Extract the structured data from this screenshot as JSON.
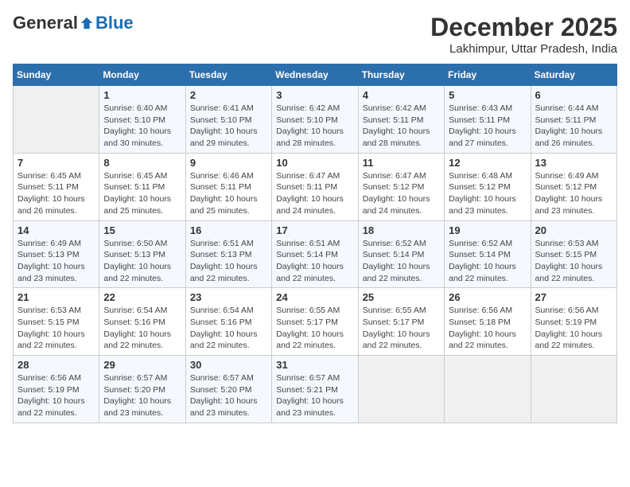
{
  "logo": {
    "general": "General",
    "blue": "Blue"
  },
  "title": "December 2025",
  "subtitle": "Lakhimpur, Uttar Pradesh, India",
  "days_of_week": [
    "Sunday",
    "Monday",
    "Tuesday",
    "Wednesday",
    "Thursday",
    "Friday",
    "Saturday"
  ],
  "weeks": [
    [
      {
        "day": "",
        "info": ""
      },
      {
        "day": "1",
        "info": "Sunrise: 6:40 AM\nSunset: 5:10 PM\nDaylight: 10 hours\nand 30 minutes."
      },
      {
        "day": "2",
        "info": "Sunrise: 6:41 AM\nSunset: 5:10 PM\nDaylight: 10 hours\nand 29 minutes."
      },
      {
        "day": "3",
        "info": "Sunrise: 6:42 AM\nSunset: 5:10 PM\nDaylight: 10 hours\nand 28 minutes."
      },
      {
        "day": "4",
        "info": "Sunrise: 6:42 AM\nSunset: 5:11 PM\nDaylight: 10 hours\nand 28 minutes."
      },
      {
        "day": "5",
        "info": "Sunrise: 6:43 AM\nSunset: 5:11 PM\nDaylight: 10 hours\nand 27 minutes."
      },
      {
        "day": "6",
        "info": "Sunrise: 6:44 AM\nSunset: 5:11 PM\nDaylight: 10 hours\nand 26 minutes."
      }
    ],
    [
      {
        "day": "7",
        "info": "Sunrise: 6:45 AM\nSunset: 5:11 PM\nDaylight: 10 hours\nand 26 minutes."
      },
      {
        "day": "8",
        "info": "Sunrise: 6:45 AM\nSunset: 5:11 PM\nDaylight: 10 hours\nand 25 minutes."
      },
      {
        "day": "9",
        "info": "Sunrise: 6:46 AM\nSunset: 5:11 PM\nDaylight: 10 hours\nand 25 minutes."
      },
      {
        "day": "10",
        "info": "Sunrise: 6:47 AM\nSunset: 5:11 PM\nDaylight: 10 hours\nand 24 minutes."
      },
      {
        "day": "11",
        "info": "Sunrise: 6:47 AM\nSunset: 5:12 PM\nDaylight: 10 hours\nand 24 minutes."
      },
      {
        "day": "12",
        "info": "Sunrise: 6:48 AM\nSunset: 5:12 PM\nDaylight: 10 hours\nand 23 minutes."
      },
      {
        "day": "13",
        "info": "Sunrise: 6:49 AM\nSunset: 5:12 PM\nDaylight: 10 hours\nand 23 minutes."
      }
    ],
    [
      {
        "day": "14",
        "info": "Sunrise: 6:49 AM\nSunset: 5:13 PM\nDaylight: 10 hours\nand 23 minutes."
      },
      {
        "day": "15",
        "info": "Sunrise: 6:50 AM\nSunset: 5:13 PM\nDaylight: 10 hours\nand 22 minutes."
      },
      {
        "day": "16",
        "info": "Sunrise: 6:51 AM\nSunset: 5:13 PM\nDaylight: 10 hours\nand 22 minutes."
      },
      {
        "day": "17",
        "info": "Sunrise: 6:51 AM\nSunset: 5:14 PM\nDaylight: 10 hours\nand 22 minutes."
      },
      {
        "day": "18",
        "info": "Sunrise: 6:52 AM\nSunset: 5:14 PM\nDaylight: 10 hours\nand 22 minutes."
      },
      {
        "day": "19",
        "info": "Sunrise: 6:52 AM\nSunset: 5:14 PM\nDaylight: 10 hours\nand 22 minutes."
      },
      {
        "day": "20",
        "info": "Sunrise: 6:53 AM\nSunset: 5:15 PM\nDaylight: 10 hours\nand 22 minutes."
      }
    ],
    [
      {
        "day": "21",
        "info": "Sunrise: 6:53 AM\nSunset: 5:15 PM\nDaylight: 10 hours\nand 22 minutes."
      },
      {
        "day": "22",
        "info": "Sunrise: 6:54 AM\nSunset: 5:16 PM\nDaylight: 10 hours\nand 22 minutes."
      },
      {
        "day": "23",
        "info": "Sunrise: 6:54 AM\nSunset: 5:16 PM\nDaylight: 10 hours\nand 22 minutes."
      },
      {
        "day": "24",
        "info": "Sunrise: 6:55 AM\nSunset: 5:17 PM\nDaylight: 10 hours\nand 22 minutes."
      },
      {
        "day": "25",
        "info": "Sunrise: 6:55 AM\nSunset: 5:17 PM\nDaylight: 10 hours\nand 22 minutes."
      },
      {
        "day": "26",
        "info": "Sunrise: 6:56 AM\nSunset: 5:18 PM\nDaylight: 10 hours\nand 22 minutes."
      },
      {
        "day": "27",
        "info": "Sunrise: 6:56 AM\nSunset: 5:19 PM\nDaylight: 10 hours\nand 22 minutes."
      }
    ],
    [
      {
        "day": "28",
        "info": "Sunrise: 6:56 AM\nSunset: 5:19 PM\nDaylight: 10 hours\nand 22 minutes."
      },
      {
        "day": "29",
        "info": "Sunrise: 6:57 AM\nSunset: 5:20 PM\nDaylight: 10 hours\nand 23 minutes."
      },
      {
        "day": "30",
        "info": "Sunrise: 6:57 AM\nSunset: 5:20 PM\nDaylight: 10 hours\nand 23 minutes."
      },
      {
        "day": "31",
        "info": "Sunrise: 6:57 AM\nSunset: 5:21 PM\nDaylight: 10 hours\nand 23 minutes."
      },
      {
        "day": "",
        "info": ""
      },
      {
        "day": "",
        "info": ""
      },
      {
        "day": "",
        "info": ""
      }
    ]
  ]
}
